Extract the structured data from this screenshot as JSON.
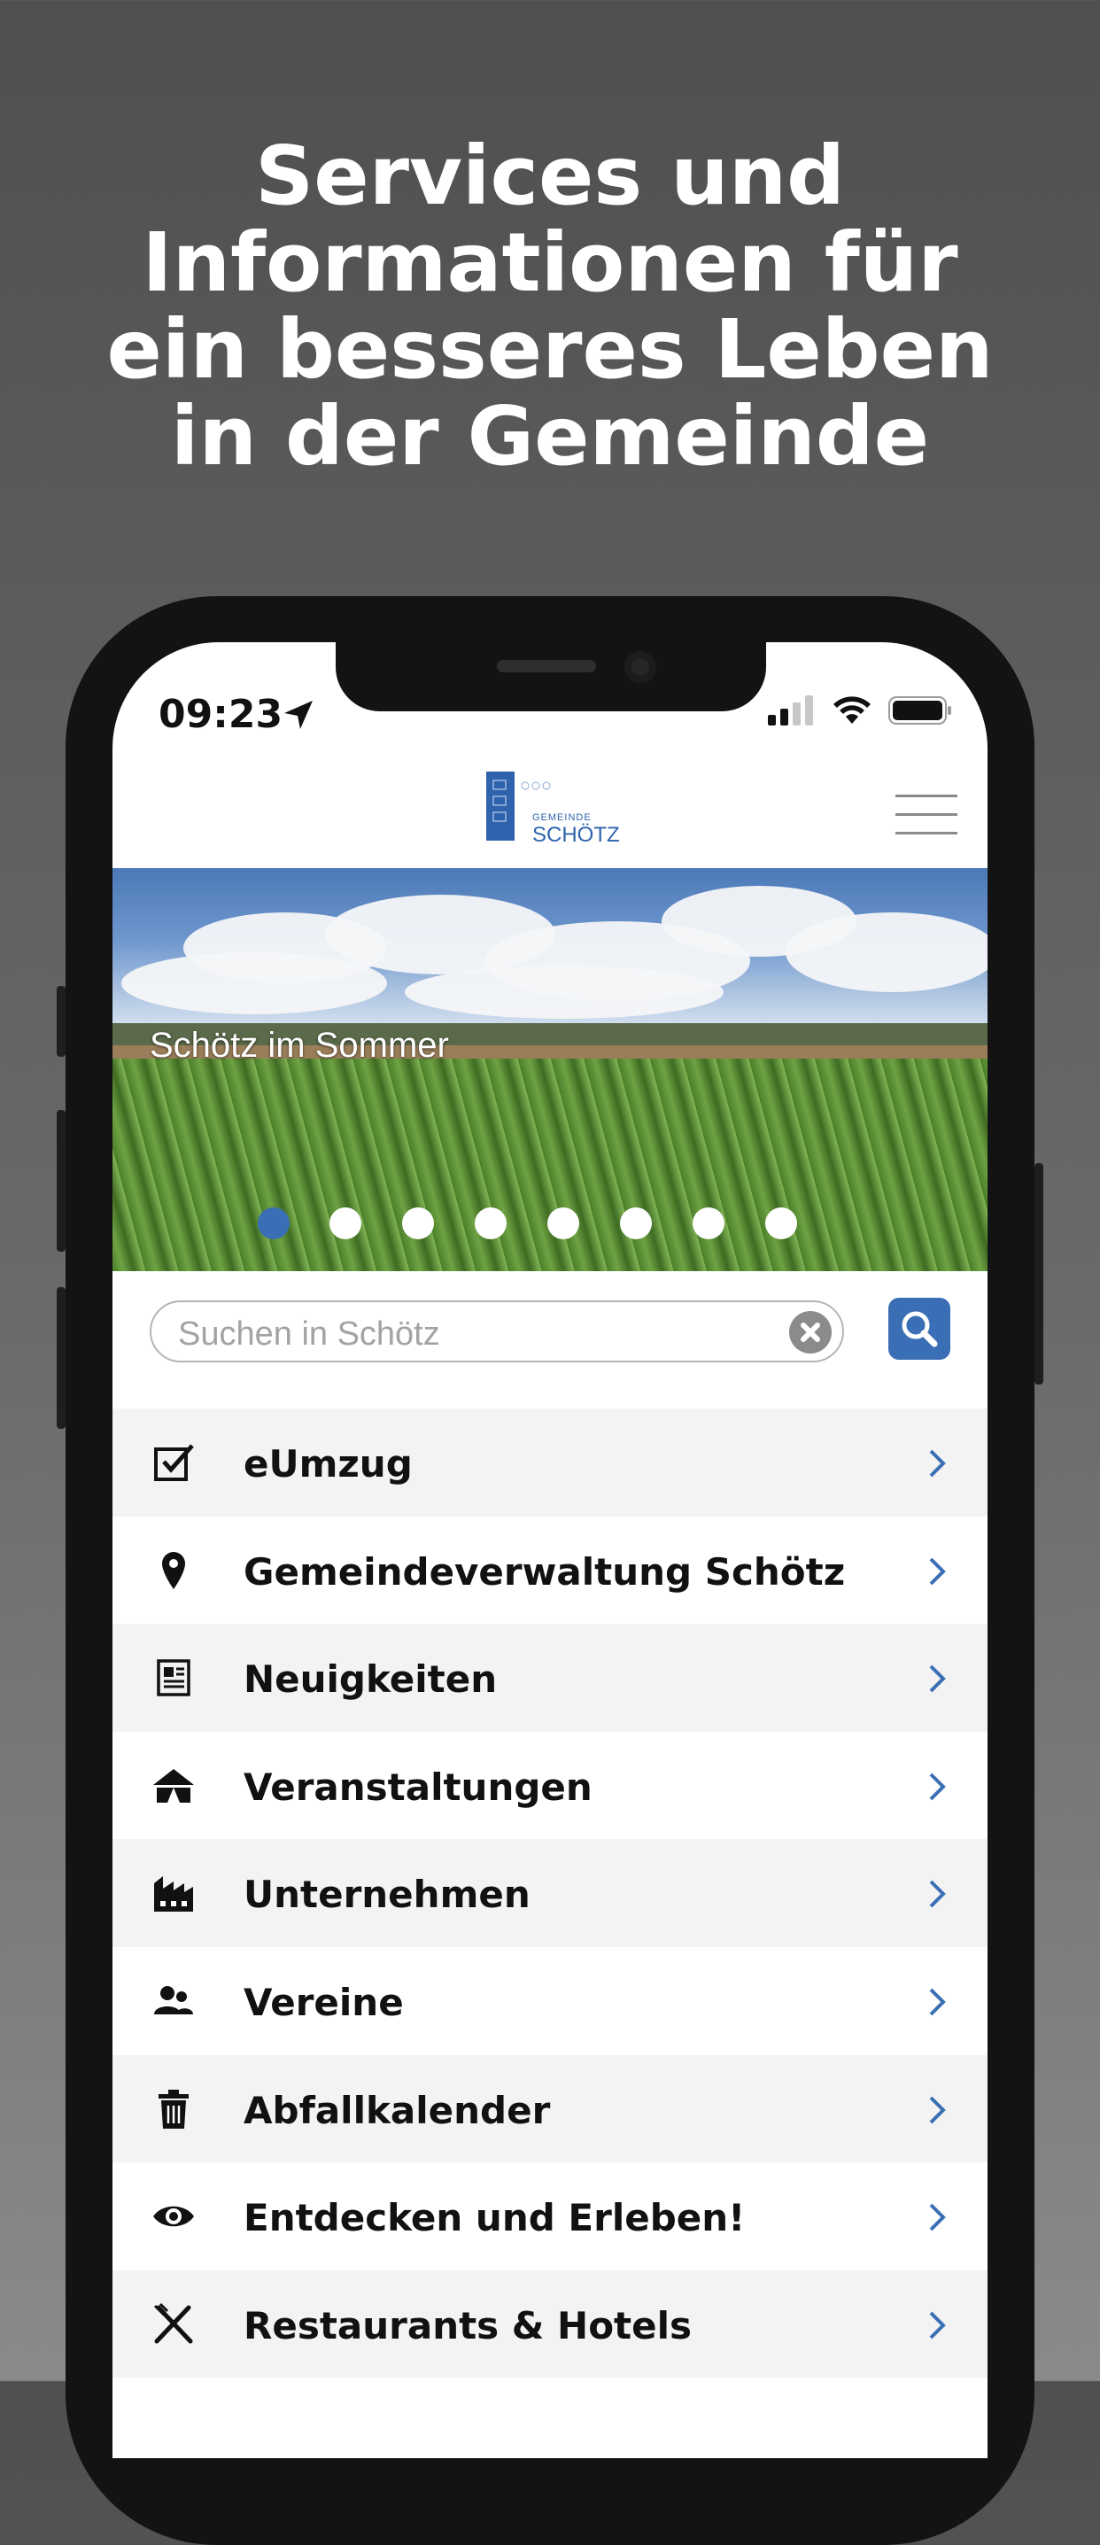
{
  "headline": {
    "line1": "Services und",
    "line2": "Informationen für",
    "line3": "ein besseres Leben",
    "line4": "in der Gemeinde"
  },
  "status_bar": {
    "time": "09:23",
    "icons": [
      "location-arrow-icon",
      "signal-icon",
      "wifi-icon",
      "battery-icon"
    ]
  },
  "header": {
    "logo_small": "GEMEINDE",
    "logo_big": "SCHÖTZ",
    "menu_icon": "hamburger-icon"
  },
  "hero": {
    "caption": "Schötz im Sommer",
    "slide_count": 8,
    "active_slide": 1
  },
  "search": {
    "placeholder": "Suchen in Schötz",
    "clear_icon": "clear-icon",
    "search_icon": "search-icon"
  },
  "menu": {
    "items": [
      {
        "label": "eUmzug",
        "icon": "checkbox-icon"
      },
      {
        "label": "Gemeindeverwaltung Schötz",
        "icon": "location-pin-icon"
      },
      {
        "label": "Neuigkeiten",
        "icon": "newspaper-icon"
      },
      {
        "label": "Veranstaltungen",
        "icon": "tent-icon"
      },
      {
        "label": "Unternehmen",
        "icon": "factory-icon"
      },
      {
        "label": "Vereine",
        "icon": "group-icon"
      },
      {
        "label": "Abfallkalender",
        "icon": "trash-icon"
      },
      {
        "label": "Entdecken und Erleben!",
        "icon": "eye-icon"
      },
      {
        "label": "Restaurants & Hotels",
        "icon": "cutlery-icon"
      }
    ]
  },
  "colors": {
    "accent": "#3a6fb5",
    "chevron": "#3a6fb5",
    "row_alt": "#f3f3f3"
  }
}
